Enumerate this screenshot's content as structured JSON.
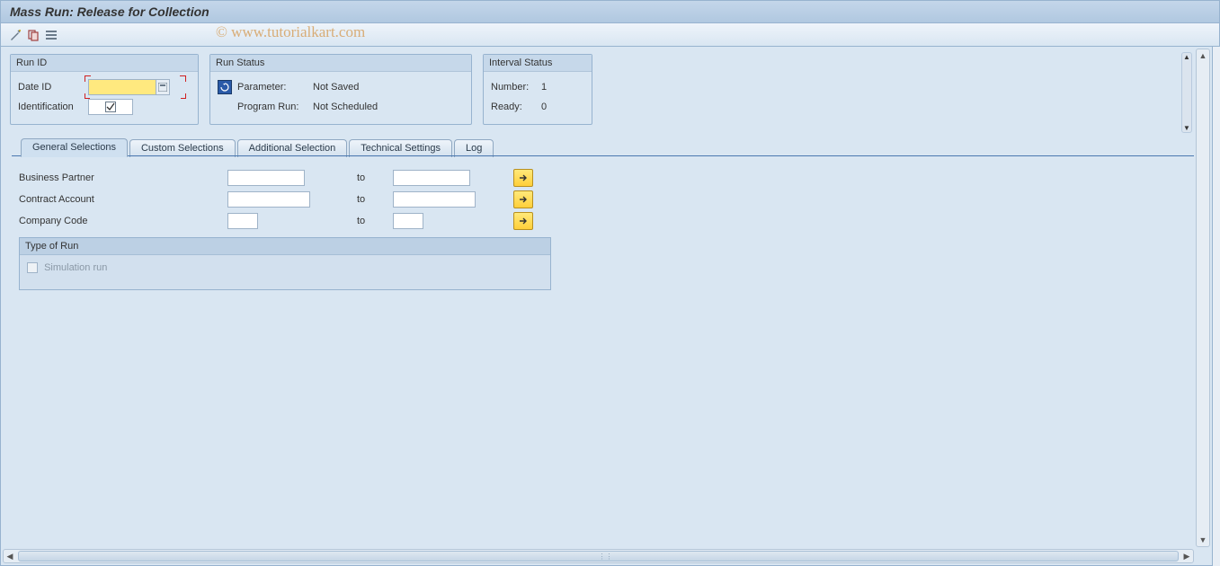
{
  "title": "Mass Run: Release for Collection",
  "watermark": "© www.tutorialkart.com",
  "toolbar": {
    "icons": [
      "wand-icon",
      "copy-icon",
      "layout-icon"
    ]
  },
  "panels": {
    "run_id": {
      "title": "Run ID",
      "date_label": "Date ID",
      "date_value": "",
      "ident_label": "Identification",
      "ident_value": ""
    },
    "run_status": {
      "title": "Run Status",
      "param_label": "Parameter:",
      "param_value": "Not Saved",
      "prog_label": "Program Run:",
      "prog_value": "Not Scheduled"
    },
    "interval": {
      "title": "Interval Status",
      "number_label": "Number:",
      "number_value": "1",
      "ready_label": "Ready:",
      "ready_value": "0"
    }
  },
  "tabs": [
    {
      "id": "general",
      "label": "General Selections",
      "active": true
    },
    {
      "id": "custom",
      "label": "Custom Selections",
      "active": false
    },
    {
      "id": "additional",
      "label": "Additional Selection",
      "active": false
    },
    {
      "id": "technical",
      "label": "Technical Settings",
      "active": false
    },
    {
      "id": "log",
      "label": "Log",
      "active": false
    }
  ],
  "selection": {
    "rows": [
      {
        "label": "Business Partner",
        "from": "",
        "to_label": "to",
        "to": ""
      },
      {
        "label": "Contract Account",
        "from": "",
        "to_label": "to",
        "to": ""
      },
      {
        "label": "Company Code",
        "from": "",
        "to_label": "to",
        "to": ""
      }
    ],
    "type_of_run_title": "Type of Run",
    "simulation_label": "Simulation run",
    "simulation_checked": false
  }
}
